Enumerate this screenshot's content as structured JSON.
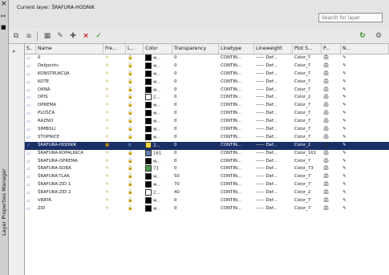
{
  "palette": {
    "selected": "#1b2f67",
    "header": "#f0f0f0",
    "panel": "#e4e4e4",
    "text": "#111111"
  },
  "top": {
    "current_layer_label": "Current layer: ŠRAFURA-HODNIK",
    "search_placeholder": "Search for layer"
  },
  "side_title": "Layer Properties Manager",
  "columns": [
    "S..",
    "Name",
    "Fre...",
    "L...",
    "Color",
    "Transparency",
    "Linetype",
    "Lineweight",
    "Plot S...",
    "P...",
    "N..."
  ],
  "rows": [
    {
      "name": "0",
      "color_name": "w...",
      "color": "#000000",
      "transparency": "0",
      "linetype": "CONTIN...",
      "lineweight": "—— Def...",
      "plot_style": "Color_7"
    },
    {
      "name": "Defpoints",
      "color_name": "w...",
      "color": "#000000",
      "transparency": "0",
      "linetype": "CONTIN...",
      "lineweight": "—— Def...",
      "plot_style": "Color_7"
    },
    {
      "name": "KONSTRUKCIJA",
      "color_name": "w...",
      "color": "#000000",
      "transparency": "0",
      "linetype": "CONTIN...",
      "lineweight": "—— Def...",
      "plot_style": "Color_7"
    },
    {
      "name": "KOTE",
      "color_name": "w...",
      "color": "#000000",
      "transparency": "0",
      "linetype": "CONTIN...",
      "lineweight": "—— Def...",
      "plot_style": "Color_7"
    },
    {
      "name": "OKNA",
      "color_name": "w...",
      "color": "#000000",
      "transparency": "0",
      "linetype": "CONTIN...",
      "lineweight": "—— Def...",
      "plot_style": "Color_7"
    },
    {
      "name": "OPIS",
      "color_name": "2...",
      "color": "#ffffff",
      "transparency": "0",
      "linetype": "CONTIN...",
      "lineweight": "—— Def...",
      "plot_style": "Color_2"
    },
    {
      "name": "OPREMA",
      "color_name": "w...",
      "color": "#000000",
      "transparency": "0",
      "linetype": "CONTIN...",
      "lineweight": "—— Def...",
      "plot_style": "Color_7"
    },
    {
      "name": "PLOŠČA",
      "color_name": "w...",
      "color": "#000000",
      "transparency": "0",
      "linetype": "CONTIN...",
      "lineweight": "—— Def...",
      "plot_style": "Color_7"
    },
    {
      "name": "RAZNO",
      "color_name": "w...",
      "color": "#000000",
      "transparency": "0",
      "linetype": "CONTIN...",
      "lineweight": "—— Def...",
      "plot_style": "Color_7"
    },
    {
      "name": "SIMBOLI",
      "color_name": "w...",
      "color": "#000000",
      "transparency": "0",
      "linetype": "CONTIN...",
      "lineweight": "—— Def...",
      "plot_style": "Color_7"
    },
    {
      "name": "STOPNICE",
      "color_name": "w...",
      "color": "#000000",
      "transparency": "0",
      "linetype": "CONTIN...",
      "lineweight": "—— Def...",
      "plot_style": "Color_7"
    },
    {
      "name": "ŠRAFURA-HODNIK",
      "color_name": "2...",
      "color": "#f2d33a",
      "transparency": "0",
      "linetype": "CONTIN...",
      "lineweight": "—— Def...",
      "plot_style": "Color_2",
      "selected": true
    },
    {
      "name": "ŠRAFURA-KOPALNICA",
      "color_name": "161",
      "color": "#5f7fb0",
      "transparency": "0",
      "linetype": "CONTIN...",
      "lineweight": "—— Def...",
      "plot_style": "Color_161"
    },
    {
      "name": "ŠRAFURA-OPREMA",
      "color_name": "w...",
      "color": "#000000",
      "transparency": "0",
      "linetype": "CONTIN...",
      "lineweight": "—— Def...",
      "plot_style": "Color_7"
    },
    {
      "name": "ŠRAFURA-SOBA",
      "color_name": "73",
      "color": "#4c9f4c",
      "transparency": "0",
      "linetype": "CONTIN...",
      "lineweight": "—— Def...",
      "plot_style": "Color_73"
    },
    {
      "name": "ŠRAFURA-TLAK",
      "color_name": "w...",
      "color": "#000000",
      "transparency": "50",
      "linetype": "CONTIN...",
      "lineweight": "—— Def...",
      "plot_style": "Color_7"
    },
    {
      "name": "ŠRAFURA-ZID 1",
      "color_name": "w...",
      "color": "#000000",
      "transparency": "70",
      "linetype": "CONTIN...",
      "lineweight": "—— Def...",
      "plot_style": "Color_7"
    },
    {
      "name": "ŠRAFURA-ZID 2",
      "color_name": "2...",
      "color": "#ffffff",
      "transparency": "40",
      "linetype": "CONTIN...",
      "lineweight": "—— Def...",
      "plot_style": "Color_2"
    },
    {
      "name": "VRATA",
      "color_name": "w...",
      "color": "#000000",
      "transparency": "0",
      "linetype": "CONTIN...",
      "lineweight": "—— Def...",
      "plot_style": "Color_7"
    },
    {
      "name": "ZID",
      "color_name": "w...",
      "color": "#000000",
      "transparency": "0",
      "linetype": "CONTIN...",
      "lineweight": "—— Def...",
      "plot_style": "Color_7"
    }
  ]
}
